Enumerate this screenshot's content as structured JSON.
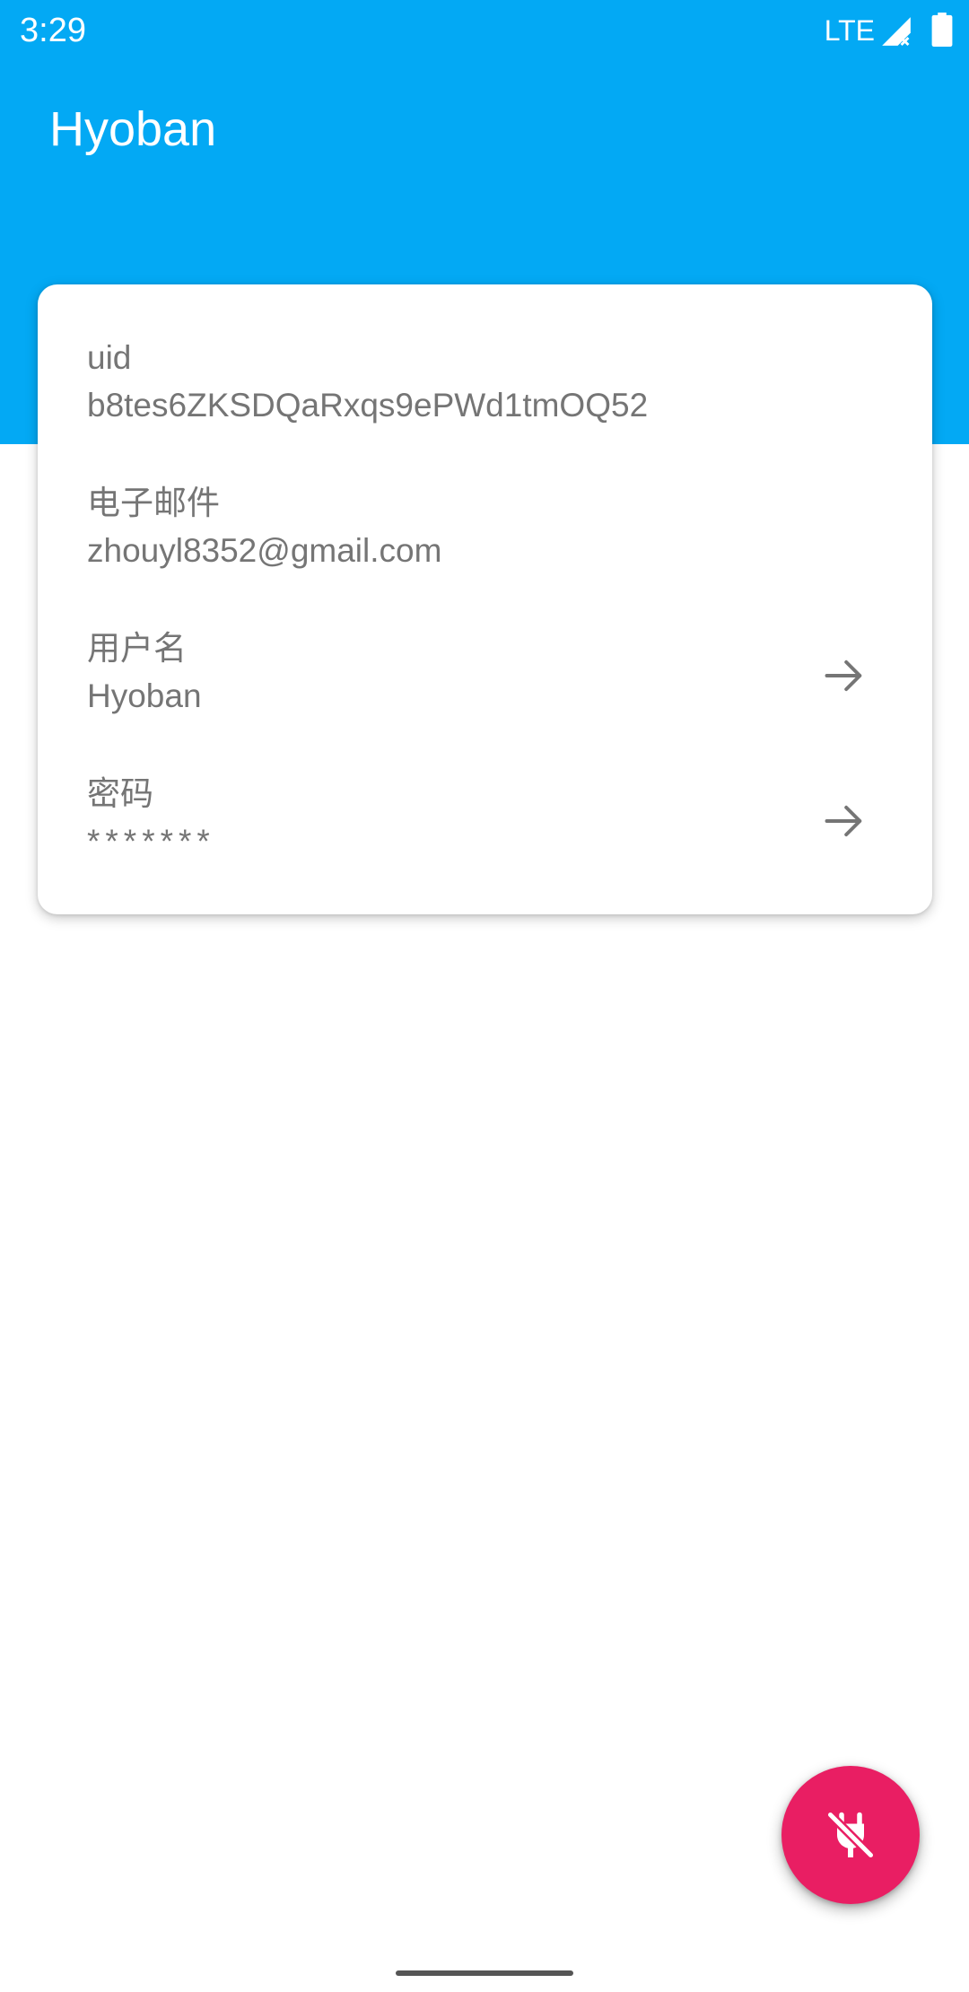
{
  "status_bar": {
    "time": "3:29",
    "network": "LTE"
  },
  "app_bar": {
    "title": "Hyoban"
  },
  "account": {
    "uid": {
      "label": "uid",
      "value": "b8tes6ZKSDQaRxqs9ePWd1tmOQ52"
    },
    "email": {
      "label": "电子邮件",
      "value": "zhouyl8352@gmail.com"
    },
    "username": {
      "label": "用户名",
      "value": "Hyoban"
    },
    "password": {
      "label": "密码",
      "value": "*******"
    }
  },
  "fab": {
    "icon": "power-off-plug-icon"
  },
  "colors": {
    "primary": "#03a9f4",
    "accent": "#e91e63",
    "text_secondary": "#757575"
  }
}
